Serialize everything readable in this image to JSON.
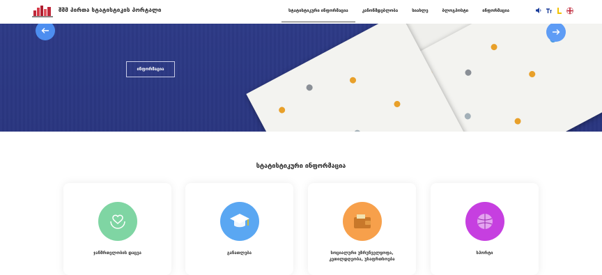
{
  "header": {
    "site_title": "შშმ პირთა სტატისტიკის პორტალი",
    "nav": [
      {
        "label": "სტატისტიკური ინფორმაცია",
        "active": true
      },
      {
        "label": "კანონმდებლობა",
        "active": false
      },
      {
        "label": "სიახლე",
        "active": false
      },
      {
        "label": "ბლოგპოსტი",
        "active": false
      },
      {
        "label": "ინფორმაცია",
        "active": false
      }
    ],
    "tools": [
      "audio-icon",
      "text-size-icon",
      "contrast-icon",
      "english-flag-icon"
    ]
  },
  "hero": {
    "button_label": "ინფორმაცია",
    "accent": "#2d3a86",
    "arrow_color": "#4d8ef0"
  },
  "section": {
    "title": "სტატისტიკური ინფორმაცია"
  },
  "cards": [
    {
      "label": "ჯანმრთელობის დაცვა",
      "icon": "health-hands-icon",
      "color": "#7fd5a3"
    },
    {
      "label": "განათლება",
      "icon": "graduation-cap-icon",
      "color": "#5aa7f2"
    },
    {
      "label": "სოციალური უზრუნველყოფა, კეთილდღეობა, უსაფრთხოება",
      "icon": "wallet-icon",
      "color": "#f7a04b"
    },
    {
      "label": "სპორტი",
      "icon": "ball-icon",
      "color": "#c63fe0"
    }
  ]
}
